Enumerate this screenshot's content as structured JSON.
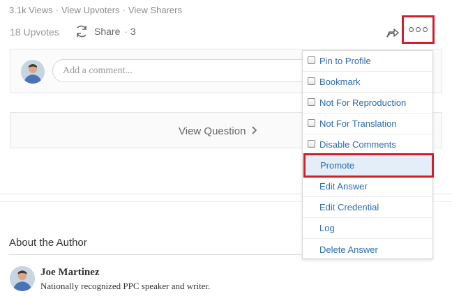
{
  "stats": {
    "views": "3.1k Views",
    "upvoters": "View Upvoters",
    "sharers": "View Sharers",
    "separator": "·"
  },
  "actions": {
    "upvotes": "18 Upvotes",
    "share_label": "Share",
    "share_separator": "·",
    "share_count": "3"
  },
  "comment": {
    "placeholder": "Add a comment..."
  },
  "view_question": {
    "label": "View Question"
  },
  "menu": {
    "items": [
      {
        "label": "Pin to Profile",
        "checkbox": true
      },
      {
        "label": "Bookmark",
        "checkbox": true
      },
      {
        "label": "Not For Reproduction",
        "checkbox": true
      },
      {
        "label": "Not For Translation",
        "checkbox": true
      },
      {
        "label": "Disable Comments",
        "checkbox": true
      },
      {
        "label": "Promote",
        "checkbox": false
      },
      {
        "label": "Edit Answer",
        "checkbox": false
      },
      {
        "label": "Edit Credential",
        "checkbox": false
      },
      {
        "label": "Log",
        "checkbox": false
      },
      {
        "label": "Delete Answer",
        "checkbox": false
      }
    ]
  },
  "about": {
    "title": "About the Author",
    "name": "Joe Martinez",
    "bio": "Nationally recognized PPC speaker and writer."
  },
  "colors": {
    "link": "#2b6dad",
    "highlight_border": "#d0202e",
    "promote_bg": "#e3eef9"
  }
}
